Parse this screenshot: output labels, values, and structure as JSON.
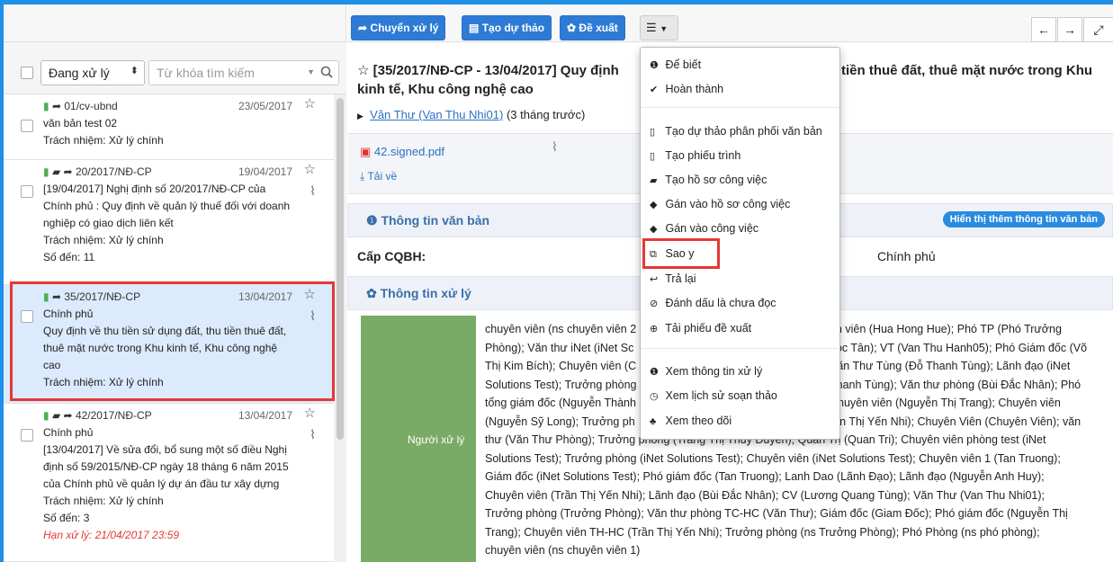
{
  "toolbar": {
    "btn_transfer": "Chuyển xử lý",
    "btn_draft": "Tạo dự thảo",
    "btn_propose": "Đề xuất"
  },
  "filter": {
    "select_value": "Đang xử lý",
    "search_placeholder": "Từ khóa tìm kiếm"
  },
  "docs": [
    {
      "code": "01/cv-ubnd",
      "date": "23/05/2017",
      "lines": [
        "văn bản test 02",
        "Trách nhiệm: Xử lý chính"
      ]
    },
    {
      "code": "20/2017/NĐ-CP",
      "date": "19/04/2017",
      "lines": [
        "[19/04/2017] Nghị định số 20/2017/NĐ-CP của",
        "Chính phủ : Quy định về quản lý thuế đối với doanh",
        "nghiệp có giao dịch liên kết",
        "Trách nhiệm: Xử lý chính",
        "Số đến: 11"
      ]
    },
    {
      "code": "35/2017/NĐ-CP",
      "date": "13/04/2017",
      "lines": [
        "Chính phủ",
        "Quy định về thu tiền sử dụng đất, thu tiền thuê đất,",
        "thuê mặt nước trong Khu kinh tế, Khu công nghệ",
        "cao",
        "Trách nhiệm: Xử lý chính"
      ]
    },
    {
      "code": "42/2017/NĐ-CP",
      "date": "13/04/2017",
      "lines": [
        "Chính phủ",
        "[13/04/2017] Về sửa đổi, bổ sung một số điều Nghị",
        "định số 59/2015/NĐ-CP ngày 18 tháng 6 năm 2015",
        "của Chính phủ về quản lý dự án đầu tư xây dựng",
        "Trách nhiệm: Xử lý chính",
        "Số đến: 3"
      ],
      "deadline": "Hạn xử lý: 21/04/2017 23:59"
    }
  ],
  "detail": {
    "title_line1": "[35/2017/NĐ-CP - 13/04/2017] Quy định",
    "title_line1_right": "tiền thuê đất, thuê mặt nước trong Khu",
    "title_line2": "kinh tế, Khu công nghệ cao",
    "sender": "Văn Thư (Van Thu Nhi01)",
    "sender_time": "(3 tháng trước)",
    "attachment": "42.signed.pdf",
    "download": "Tải về",
    "info_section": "Thông tin văn bản",
    "show_more": "Hiển thị thêm thông tin văn bản",
    "cqbh_label": "Cấp CQBH:",
    "cqbh_value": "Chính phủ",
    "process_section": "Thông tin xử lý",
    "handler_label": "Người xử lý",
    "handlers": [
      "chuyên viên (ns chuyên viên 2",
      "ên viên (Hua Hong Hue); Phó TP (Phó Trưởng",
      "Phòng); Văn thư iNet (iNet Sc",
      "gọc Tân); VT (Van Thu Hanh05); Phó Giám đốc (Võ",
      "Thị Kim Bích); Chuyên viên (C",
      "Văn Thư Tùng (Đỗ Thanh Tùng); Lãnh đạo (iNet",
      "Solutions Test); Trưởng phòng",
      "Thanh Tùng); Văn thư phòng (Bùi Đắc Nhân); Phó",
      "tổng giám đốc (Nguyễn Thành",
      "Chuyên viên (Nguyễn Thị Trang); Chuyên viên",
      "(Nguyễn Sỹ Long); Trưởng ph",
      "rần Thị Yến Nhi); Chuyên Viên (Chuyên Viên); văn",
      "thư (Văn Thư Phòng); Trưởng phòng (Trang Thị Thùy Duyên); Quản Trị (Quan Tri); Chuyên viên phòng test (iNet",
      "Solutions Test); Trưởng phòng (iNet Solutions Test); Chuyên viên (iNet Solutions Test); Chuyên viên 1 (Tan Truong);",
      "Giám đốc (iNet Solutions Test); Phó giám đốc (Tan Truong); Lanh Dao (Lãnh Đạo); Lãnh đạo (Nguyễn Anh Huy);",
      "Chuyên viên (Trần Thị Yến Nhi); Lãnh đạo (Bùi Đắc Nhân); CV (Lương Quang Tùng); Văn Thư (Van Thu Nhi01);",
      "Trưởng phòng (Trưởng Phòng); Văn thư phòng TC-HC (Văn Thư); Giám đốc (Giam Đốc); Phó giám đốc (Nguyễn Thị",
      "Trang); Chuyên viên TH-HC (Trần Thị Yến Nhi); Trưởng phòng (ns Trưởng Phòng); Phó Phòng (ns phó phòng);",
      "chuyên viên (ns chuyên viên 1)"
    ]
  },
  "menu": {
    "items": [
      "Để biết",
      "Hoàn thành",
      "Tạo dự thảo phân phối văn bản",
      "Tạo phiếu trình",
      "Tạo hồ sơ công việc",
      "Gán vào hồ sơ công việc",
      "Gán vào công việc",
      "Sao y",
      "Trả lại",
      "Đánh dấu là chưa đọc",
      "Tải phiếu đề xuất",
      "Xem thông tin xử lý",
      "Xem lịch sử soạn thảo",
      "Xem theo dõi"
    ]
  },
  "colors": {
    "accent": "#2e7bd6",
    "highlight": "#e53935",
    "green_cell": "#7aab66",
    "selected_bg": "#dbeafc"
  }
}
